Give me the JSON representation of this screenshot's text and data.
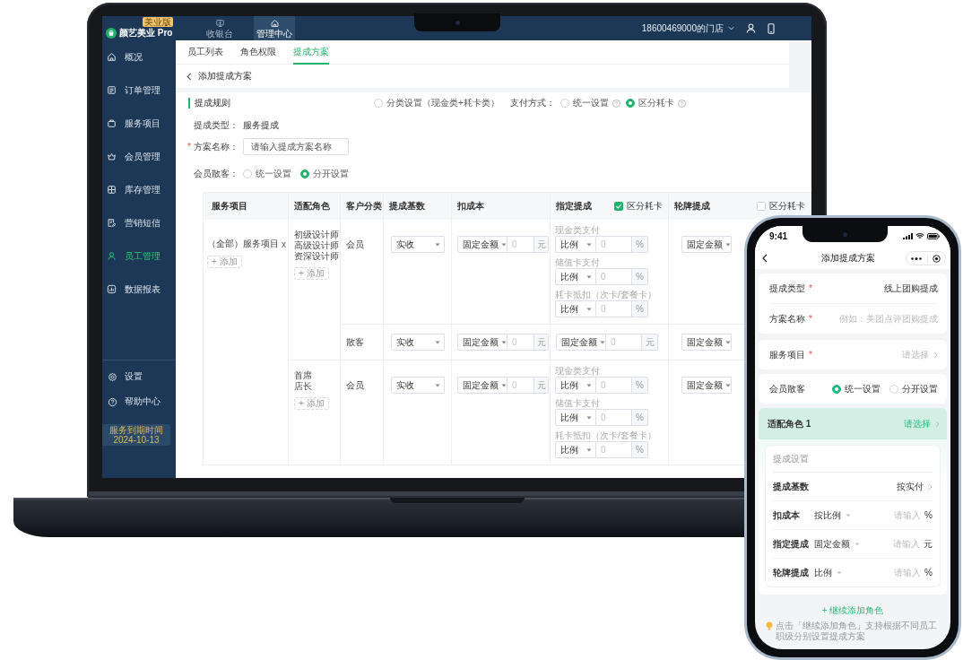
{
  "laptop": {
    "brand": {
      "name": "颜艺美业 Pro",
      "badge": "美业版"
    },
    "top_nav": [
      {
        "label": "收银台",
        "selected": false
      },
      {
        "label": "管理中心",
        "selected": true
      }
    ],
    "store": "18600469000的门店",
    "sidebar": {
      "items": [
        {
          "label": "概况",
          "selected": false
        },
        {
          "label": "订单管理",
          "selected": false
        },
        {
          "label": "服务项目",
          "selected": false
        },
        {
          "label": "会员管理",
          "selected": false
        },
        {
          "label": "库存管理",
          "selected": false
        },
        {
          "label": "营销短信",
          "selected": false
        },
        {
          "label": "员工管理",
          "selected": true
        },
        {
          "label": "数据报表",
          "selected": false
        }
      ],
      "footer_items": [
        {
          "label": "设置"
        },
        {
          "label": "帮助中心"
        }
      ],
      "expiry": {
        "label": "服务到期时间",
        "date": "2024-10-13"
      }
    },
    "tabs": [
      {
        "label": "员工列表",
        "selected": false
      },
      {
        "label": "角色权限",
        "selected": false
      },
      {
        "label": "提成方案",
        "selected": true
      }
    ],
    "page_title": "添加提成方案",
    "section_title": "提成规则",
    "category_option": {
      "label": "分类设置（现金类+耗卡类）",
      "selected": false
    },
    "payment_method": {
      "label": "支付方式：",
      "options": [
        {
          "label": "统一设置",
          "selected": false
        },
        {
          "label": "区分耗卡",
          "selected": true
        }
      ]
    },
    "fields": [
      {
        "kind": "text",
        "label": "提成类型：",
        "value": "服务提成"
      },
      {
        "kind": "input",
        "label": "方案名称：",
        "required_mark": "*",
        "placeholder": "请输入提成方案名称"
      },
      {
        "kind": "radio",
        "label": "会员散客：",
        "options": [
          {
            "label": "统一设置",
            "selected": false
          },
          {
            "label": "分开设置",
            "selected": true
          }
        ]
      }
    ],
    "table": {
      "columns": [
        {
          "label": "服务项目"
        },
        {
          "label": "适配角色"
        },
        {
          "label": "客户分类"
        },
        {
          "label": "提成基数"
        },
        {
          "label": "扣成本"
        },
        {
          "label": "指定提成",
          "toggle": {
            "label": "区分耗卡",
            "checked": true
          }
        },
        {
          "label": "轮牌提成",
          "toggle": {
            "label": "区分耗卡",
            "checked": false
          }
        }
      ],
      "service": {
        "label": "（全部）服务项目",
        "remove": "x",
        "add": "+ 添加"
      },
      "role_groups": [
        {
          "roles": [
            "初级设计师",
            "高级设计师",
            "资深设计师"
          ],
          "add": "+ 添加",
          "rows": [
            {
              "customer": "会员",
              "base": "实收",
              "cost": {
                "mode": "固定金额",
                "placeholder": "0",
                "unit": "元"
              },
              "designated": {
                "kind": "split",
                "items": [
                  {
                    "label": "现金类支付",
                    "mode": "比例",
                    "placeholder": "0",
                    "unit": "%"
                  },
                  {
                    "label": "储值卡支付",
                    "mode": "比例",
                    "placeholder": "0",
                    "unit": "%"
                  },
                  {
                    "label": "耗卡抵扣（次卡/套餐卡）",
                    "mode": "比例",
                    "placeholder": "0",
                    "unit": "%"
                  }
                ]
              },
              "rotation": {
                "mode": "固定金额"
              }
            },
            {
              "customer": "散客",
              "base": "实收",
              "cost": {
                "mode": "固定金额",
                "placeholder": "0",
                "unit": "元"
              },
              "designated": {
                "kind": "single",
                "mode": "固定金额",
                "placeholder": "0",
                "unit": "元"
              },
              "rotation": {
                "mode": "固定金额"
              }
            }
          ]
        },
        {
          "roles": [
            "首席",
            "店长"
          ],
          "add": "+ 添加",
          "rows": [
            {
              "customer": "会员",
              "base": "实收",
              "cost": {
                "mode": "固定金额",
                "placeholder": "0",
                "unit": "元"
              },
              "designated": {
                "kind": "split",
                "items": [
                  {
                    "label": "现金类支付",
                    "mode": "比例",
                    "placeholder": "0",
                    "unit": "%"
                  },
                  {
                    "label": "储值卡支付",
                    "mode": "比例",
                    "placeholder": "0",
                    "unit": "%"
                  },
                  {
                    "label": "耗卡抵扣（次卡/套餐卡）",
                    "mode": "比例",
                    "placeholder": "0",
                    "unit": "%"
                  }
                ]
              },
              "rotation": {
                "mode": "固定金额"
              }
            }
          ]
        }
      ]
    }
  },
  "phone": {
    "time": "9:41",
    "title": "添加提成方案",
    "groups": [
      {
        "rows": [
          {
            "kind": "value",
            "label": "提成类型",
            "required_mark": "*",
            "value": "线上团购提成"
          },
          {
            "kind": "input",
            "label": "方案名称",
            "required_mark": "*",
            "placeholder": "例如：美团点评团购提成"
          }
        ]
      },
      {
        "rows": [
          {
            "kind": "picker",
            "label": "服务项目",
            "required_mark": "*",
            "placeholder": "请选择"
          }
        ]
      },
      {
        "rows": [
          {
            "kind": "radio",
            "label": "会员散客",
            "options": [
              {
                "label": "统一设置",
                "selected": true
              },
              {
                "label": "分开设置",
                "selected": false
              }
            ]
          }
        ]
      }
    ],
    "role": {
      "label": "适配角色 1",
      "action": "请选择",
      "settings": {
        "title": "提成设置",
        "rows": [
          {
            "kind": "picker",
            "label": "提成基数",
            "value": "按实付"
          },
          {
            "kind": "amount",
            "label": "扣成本",
            "mode": "按比例",
            "placeholder": "请输入",
            "unit": "%"
          },
          {
            "kind": "amount",
            "label": "指定提成",
            "mode": "固定金额",
            "placeholder": "请输入",
            "unit": "元"
          },
          {
            "kind": "amount",
            "label": "轮牌提成",
            "mode": "比例",
            "placeholder": "请输入",
            "unit": "%"
          }
        ]
      }
    },
    "add_role": "+ 继续添加角色",
    "tip": "点击「继续添加角色」支持根据不同员工职级分别设置提成方案"
  }
}
